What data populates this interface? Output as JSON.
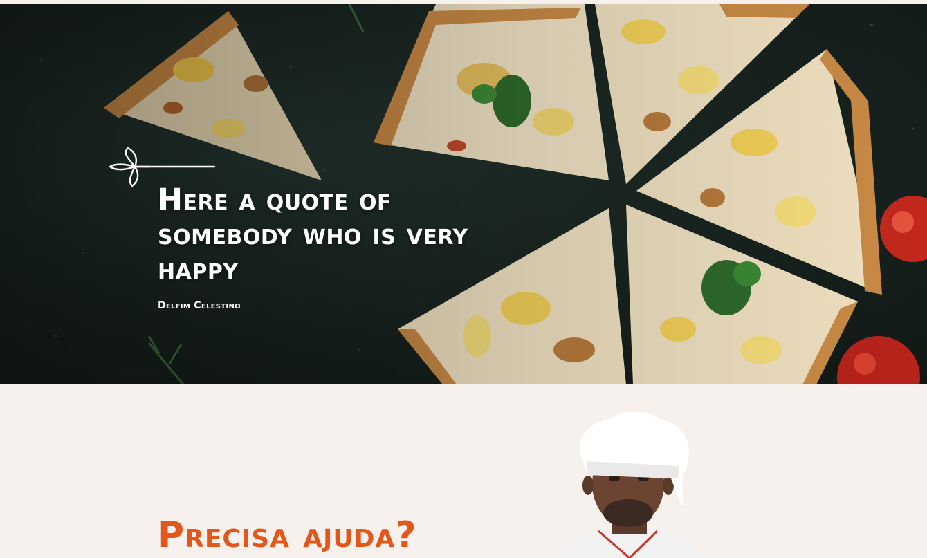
{
  "testimonial": {
    "quote": "Here a quote of somebody who is very happy",
    "author": "Delfim Celestino"
  },
  "help": {
    "title": "Precisa ajuda?"
  },
  "colors": {
    "accent": "#e4571b",
    "hero_background": "#1b2824",
    "page_background": "#f7f1ee",
    "text_light": "#ffffff"
  },
  "icons": {
    "flourish": "leaf-flourish-icon"
  }
}
